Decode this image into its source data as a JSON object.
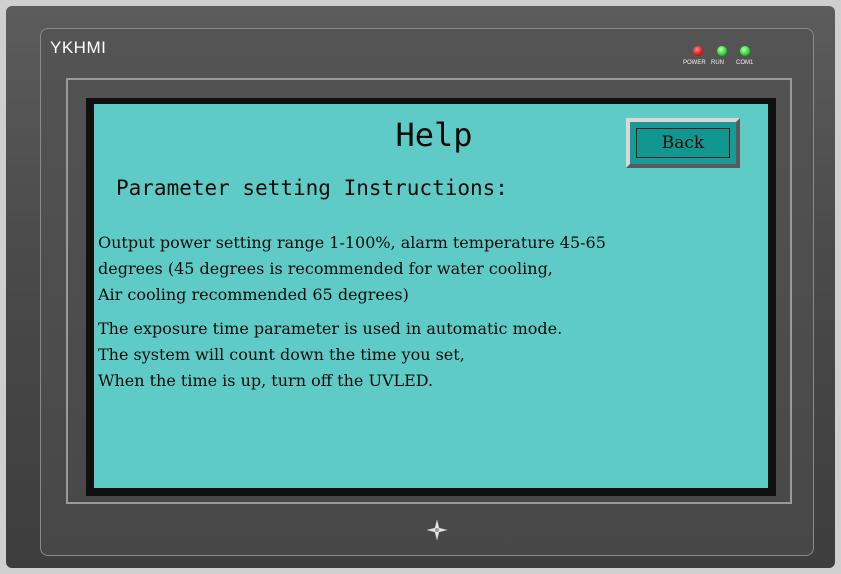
{
  "device": {
    "brand": "YKHMI",
    "indicators": [
      {
        "label": "POWER",
        "color": "#e01414"
      },
      {
        "label": "RUN",
        "color": "#22d622"
      },
      {
        "label": "COM1",
        "color": "#22d622"
      }
    ]
  },
  "screen": {
    "background_color": "#5ecbc6",
    "title": "Help",
    "back_button_label": "Back",
    "heading": "Parameter setting Instructions:",
    "paragraph1": [
      "Output power setting range 1-100%, alarm temperature 45-65",
      "degrees (45 degrees is recommended for water cooling,",
      "Air cooling recommended 65 degrees)"
    ],
    "paragraph2": [
      "The exposure time parameter is used in automatic mode.",
      "The system will count down the time you set,",
      "When the time is up, turn off the UVLED."
    ]
  },
  "bezel": {
    "nav_icon": "four-point-star-icon"
  }
}
